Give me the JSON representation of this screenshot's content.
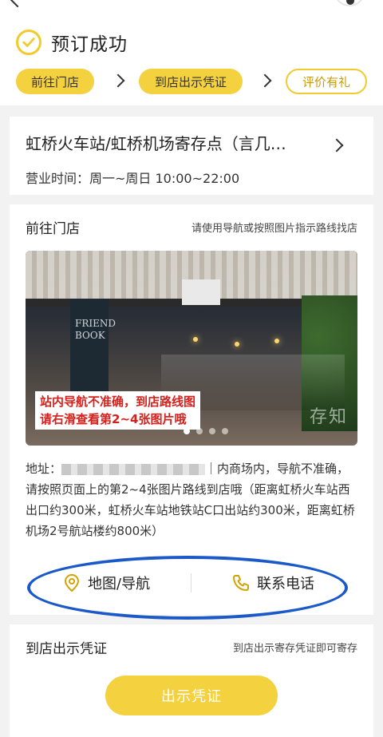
{
  "status": {
    "title": "预订成功"
  },
  "steps": [
    {
      "label": "前往门店"
    },
    {
      "label": "到店出示凭证"
    },
    {
      "label": "评价有礼"
    }
  ],
  "store": {
    "name": "虹桥火车站/虹桥机场寄存点（言几…",
    "hours": "营业时间：周一~周日 10:00~22:00"
  },
  "goto": {
    "title": "前往门店",
    "hint": "请使用导航或按照图片指示路线找店",
    "photo_notice_line1": "站内导航不准确，到店路线图",
    "photo_notice_line2": "请右滑查看第2~4张图片哦",
    "watermark": "存知",
    "address_label": "地址：",
    "address_text": "｜内商场内，导航不准确，请按照页面上的第2~4张图片路线到店哦（距离虹桥火车站西出口约300米，虹桥火车站地铁站C口出站约300米，距离虹桥机场2号航站楼约800米）"
  },
  "actions": {
    "map_label": "地图/导航",
    "phone_label": "联系电话"
  },
  "voucher": {
    "title": "到店出示凭证",
    "hint": "到店出示寄存凭证即可寄存",
    "button_label": "出示凭证"
  },
  "colors": {
    "accent": "#f4d13f",
    "annotation": "#1b59c9",
    "notice_red": "#d6201c"
  }
}
